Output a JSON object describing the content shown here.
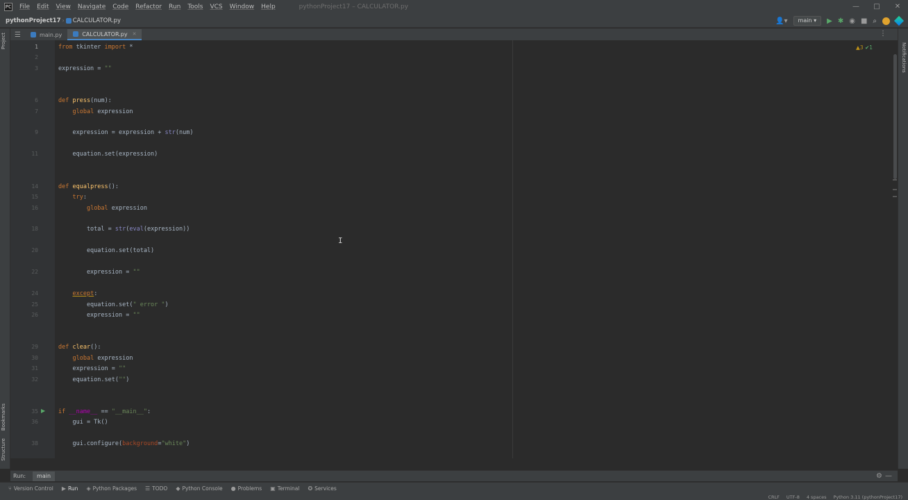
{
  "menubar": {
    "items": [
      "File",
      "Edit",
      "View",
      "Navigate",
      "Code",
      "Refactor",
      "Run",
      "Tools",
      "VCS",
      "Window",
      "Help"
    ],
    "window_title": "pythonProject17 – CALCULATOR.py",
    "controls": [
      "—",
      "□",
      "✕"
    ]
  },
  "navbar": {
    "project": "pythonProject17",
    "file": "CALCULATOR.py",
    "run_config": "main"
  },
  "tool_strips": {
    "project": "Project",
    "bookmarks": "Bookmarks",
    "structure": "Structure",
    "notifications": "Notifications"
  },
  "tabs": [
    {
      "label": "main.py",
      "active": false
    },
    {
      "label": "CALCULATOR.py",
      "active": true
    }
  ],
  "inspection": {
    "warnings": "▲3",
    "ok": "✔1"
  },
  "gutter_lines": [
    "1",
    "2",
    "3",
    "4",
    "5",
    "6",
    "7",
    "8",
    "9",
    "10",
    "11",
    "12",
    "13",
    "14",
    "15",
    "16",
    "17",
    "18",
    "19",
    "20",
    "21",
    "22",
    "23",
    "24",
    "25",
    "26",
    "27",
    "28",
    "29",
    "30",
    "31",
    "32",
    "33",
    "34",
    "35",
    "36",
    "37",
    "38",
    "39"
  ],
  "code": {
    "l1": [
      "from",
      " tkinter ",
      "import",
      " *"
    ],
    "l3": [
      "expression = ",
      "\"\""
    ],
    "l6": [
      "def",
      " ",
      "press",
      "(",
      "num",
      "):"
    ],
    "l7": [
      "    ",
      "global",
      " expression"
    ],
    "l9": [
      "    expression = expression + ",
      "str",
      "(num)"
    ],
    "l11": [
      "    equation.set(expression)"
    ],
    "l14": [
      "def",
      " ",
      "equalpress",
      "():"
    ],
    "l15": [
      "    ",
      "try",
      ":"
    ],
    "l16": [
      "        ",
      "global",
      " expression"
    ],
    "l18": [
      "        total = ",
      "str",
      "(",
      "eval",
      "(expression))"
    ],
    "l20": [
      "        equation.set(total)"
    ],
    "l22": [
      "        expression = ",
      "\"\""
    ],
    "l24": [
      "    ",
      "except",
      ":"
    ],
    "l25": [
      "        equation.set(",
      "\" error \"",
      ")"
    ],
    "l26": [
      "        expression = ",
      "\"\""
    ],
    "l29": [
      "def",
      " ",
      "clear",
      "():"
    ],
    "l30": [
      "    ",
      "global",
      " expression"
    ],
    "l31": [
      "    expression = ",
      "\"\""
    ],
    "l32": [
      "    equation.set(",
      "\"\"",
      ")"
    ],
    "l35": [
      "if",
      " ",
      "__name__",
      " == ",
      "\"__main__\"",
      ":"
    ],
    "l36": [
      "    gui = Tk()"
    ],
    "l38": [
      "    gui.configure(",
      "background",
      "=",
      "\"white\"",
      ")"
    ]
  },
  "run_window": {
    "label": "Run:",
    "tab": "main"
  },
  "bottom_tools": [
    "Version Control",
    "Run",
    "Python Packages",
    "TODO",
    "Python Console",
    "Problems",
    "Terminal",
    "Services"
  ],
  "status": {
    "line_sep": "CRLF",
    "encoding": "UTF-8",
    "indent": "4 spaces",
    "interpreter": "Python 3.11 (pythonProject17)"
  }
}
